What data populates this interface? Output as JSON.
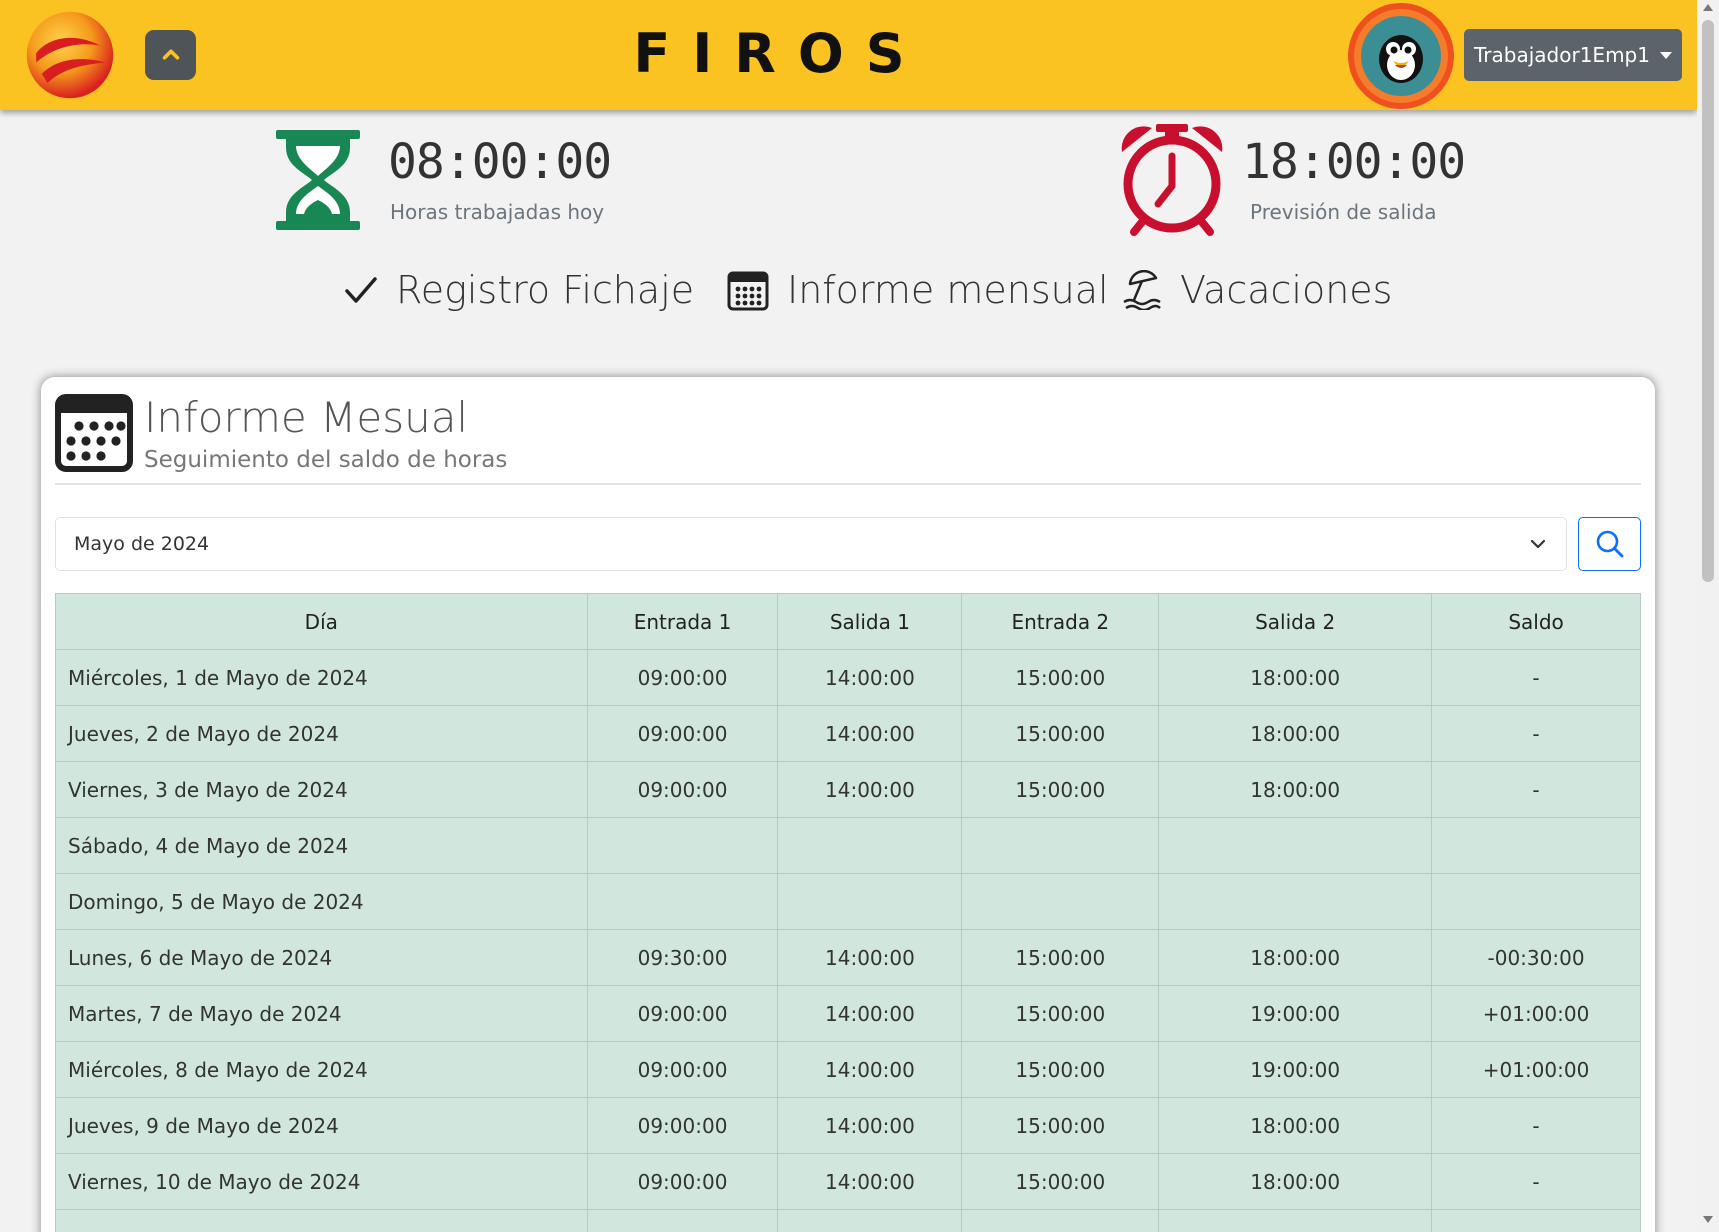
{
  "header": {
    "brand": "FIROS",
    "user_label": "Trabajador1Emp1"
  },
  "stats": {
    "worked": {
      "time": "08:00:00",
      "label": "Horas trabajadas hoy",
      "icon": "hourglass-icon",
      "color": "#198754"
    },
    "exit": {
      "time": "18:00:00",
      "label": "Previsión de salida",
      "icon": "alarm-clock-icon",
      "color": "#c8102e"
    }
  },
  "nav": [
    {
      "label": "Registro Fichaje",
      "icon": "check-icon"
    },
    {
      "label": "Informe mensual",
      "icon": "calendar-icon"
    },
    {
      "label": "Vacaciones",
      "icon": "beach-umbrella-icon"
    }
  ],
  "report": {
    "title": "Informe Mesual",
    "subtitle": "Seguimiento del saldo de horas",
    "selected_month": "Mayo de 2024",
    "columns": [
      "Día",
      "Entrada 1",
      "Salida 1",
      "Entrada 2",
      "Salida 2",
      "Saldo"
    ],
    "rows": [
      [
        "Miércoles, 1 de Mayo de 2024",
        "09:00:00",
        "14:00:00",
        "15:00:00",
        "18:00:00",
        "-"
      ],
      [
        "Jueves, 2 de Mayo de 2024",
        "09:00:00",
        "14:00:00",
        "15:00:00",
        "18:00:00",
        "-"
      ],
      [
        "Viernes, 3 de Mayo de 2024",
        "09:00:00",
        "14:00:00",
        "15:00:00",
        "18:00:00",
        "-"
      ],
      [
        "Sábado, 4 de Mayo de 2024",
        "",
        "",
        "",
        "",
        ""
      ],
      [
        "Domingo, 5 de Mayo de 2024",
        "",
        "",
        "",
        "",
        ""
      ],
      [
        "Lunes, 6 de Mayo de 2024",
        "09:30:00",
        "14:00:00",
        "15:00:00",
        "18:00:00",
        "-00:30:00"
      ],
      [
        "Martes, 7 de Mayo de 2024",
        "09:00:00",
        "14:00:00",
        "15:00:00",
        "19:00:00",
        "+01:00:00"
      ],
      [
        "Miércoles, 8 de Mayo de 2024",
        "09:00:00",
        "14:00:00",
        "15:00:00",
        "19:00:00",
        "+01:00:00"
      ],
      [
        "Jueves, 9 de Mayo de 2024",
        "09:00:00",
        "14:00:00",
        "15:00:00",
        "18:00:00",
        "-"
      ],
      [
        "Viernes, 10 de Mayo de 2024",
        "09:00:00",
        "14:00:00",
        "15:00:00",
        "18:00:00",
        "-"
      ],
      [
        "",
        "",
        "",
        "",
        "",
        ""
      ]
    ]
  },
  "colors": {
    "header_bg": "#fbc321",
    "table_bg": "#d1e7dd",
    "button_dark": "#5c636a",
    "primary": "#0d6efd"
  }
}
